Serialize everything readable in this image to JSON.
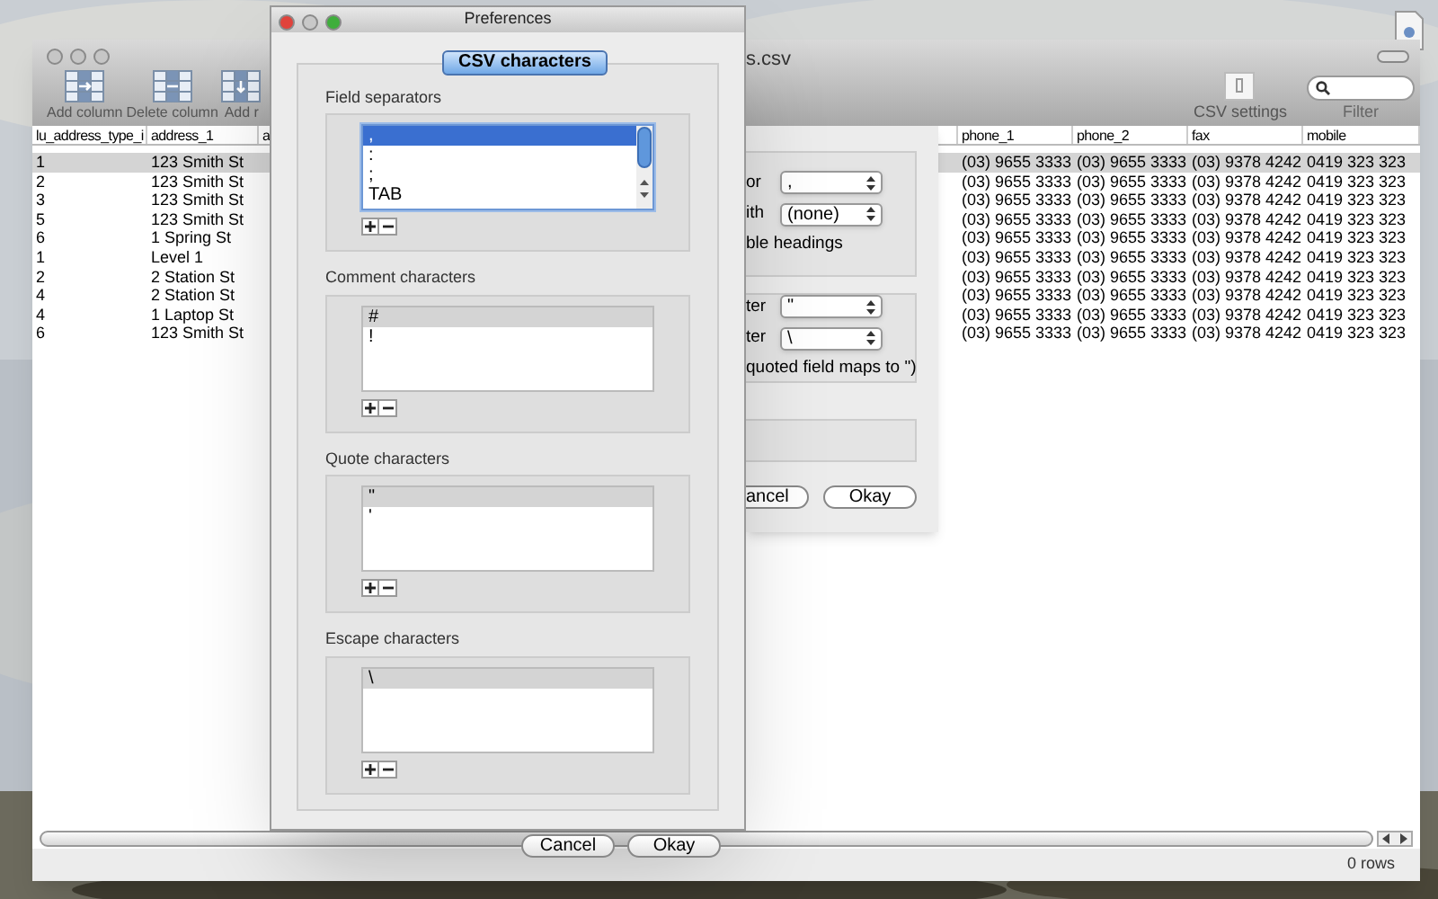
{
  "main_window": {
    "title": "s.csv",
    "toolbar": [
      {
        "label": "Add column",
        "kind": "add-column"
      },
      {
        "label": "Delete column",
        "kind": "delete-column"
      },
      {
        "label": "Add r",
        "kind": "add-row"
      }
    ],
    "csv_settings": {
      "label": "CSV settings"
    },
    "filter": {
      "label": "Filter"
    },
    "table": {
      "columns": [
        "lu_address_type_i",
        "address_1",
        "a",
        "phone_1",
        "phone_2",
        "fax",
        "mobile"
      ],
      "rows": [
        {
          "selected": true,
          "cells": [
            "1",
            "123 Smith St",
            "",
            "(03) 9655 3333",
            "(03) 9655 3333",
            "(03) 9378 4242",
            "0419 323 323"
          ]
        },
        {
          "selected": false,
          "cells": [
            "2",
            "123 Smith St",
            "",
            "(03) 9655 3333",
            "(03) 9655 3333",
            "(03) 9378 4242",
            "0419 323 323"
          ]
        },
        {
          "selected": false,
          "cells": [
            "3",
            "123 Smith St",
            "",
            "(03) 9655 3333",
            "(03) 9655 3333",
            "(03) 9378 4242",
            "0419 323 323"
          ]
        },
        {
          "selected": false,
          "cells": [
            "5",
            "123 Smith St",
            "",
            "(03) 9655 3333",
            "(03) 9655 3333",
            "(03) 9378 4242",
            "0419 323 323"
          ]
        },
        {
          "selected": false,
          "cells": [
            "6",
            "1 Spring St",
            "",
            "(03) 9655 3333",
            "(03) 9655 3333",
            "(03) 9378 4242",
            "0419 323 323"
          ]
        },
        {
          "selected": false,
          "cells": [
            "1",
            "Level 1",
            "",
            "(03) 9655 3333",
            "(03) 9655 3333",
            "(03) 9378 4242",
            "0419 323 323"
          ]
        },
        {
          "selected": false,
          "cells": [
            "2",
            "2 Station St",
            "",
            "(03) 9655 3333",
            "(03) 9655 3333",
            "(03) 9378 4242",
            "0419 323 323"
          ]
        },
        {
          "selected": false,
          "cells": [
            "4",
            "2 Station St",
            "",
            "(03) 9655 3333",
            "(03) 9655 3333",
            "(03) 9378 4242",
            "0419 323 323"
          ]
        },
        {
          "selected": false,
          "cells": [
            "4",
            "1 Laptop St",
            "",
            "(03) 9655 3333",
            "(03) 9655 3333",
            "(03) 9378 4242",
            "0419 323 323"
          ]
        },
        {
          "selected": false,
          "cells": [
            "6",
            "123 Smith St",
            "",
            "(03) 9655 3333",
            "(03) 9655 3333",
            "(03) 9378 4242",
            "0419 323 323"
          ]
        }
      ]
    },
    "status": "0 rows"
  },
  "settings_sheet": {
    "groups": [
      [
        {
          "kind": "select",
          "label": "or",
          "value": ","
        },
        {
          "kind": "select",
          "label": "ith",
          "value": "(none)"
        },
        {
          "kind": "text",
          "label": "ble headings"
        }
      ],
      [
        {
          "kind": "select",
          "label": "ter",
          "value": "\""
        },
        {
          "kind": "select",
          "label": "ter",
          "value": "\\"
        },
        {
          "kind": "text",
          "label": "quoted field maps to \")"
        }
      ]
    ],
    "buttons": [
      "ancel",
      "Okay"
    ]
  },
  "preferences": {
    "title": "Preferences",
    "tab": {
      "label": "CSV characters",
      "selected": true
    },
    "groups": [
      {
        "title": "Field separators",
        "focused": true,
        "scrollbar": true,
        "items": [
          {
            "label": ",",
            "selected": true
          },
          {
            "label": ":",
            "selected": false
          },
          {
            "label": ";",
            "selected": false
          },
          {
            "label": "TAB",
            "selected": false
          }
        ]
      },
      {
        "title": "Comment characters",
        "focused": false,
        "scrollbar": false,
        "items": [
          {
            "label": "#",
            "selected": true
          },
          {
            "label": "!",
            "selected": false
          }
        ]
      },
      {
        "title": "Quote characters",
        "focused": false,
        "scrollbar": false,
        "items": [
          {
            "label": "\"",
            "selected": true
          },
          {
            "label": "'",
            "selected": false
          }
        ]
      },
      {
        "title": "Escape characters",
        "focused": false,
        "scrollbar": false,
        "items": [
          {
            "label": "\\",
            "selected": true
          }
        ]
      }
    ],
    "buttons": [
      "Cancel",
      "Okay"
    ]
  }
}
